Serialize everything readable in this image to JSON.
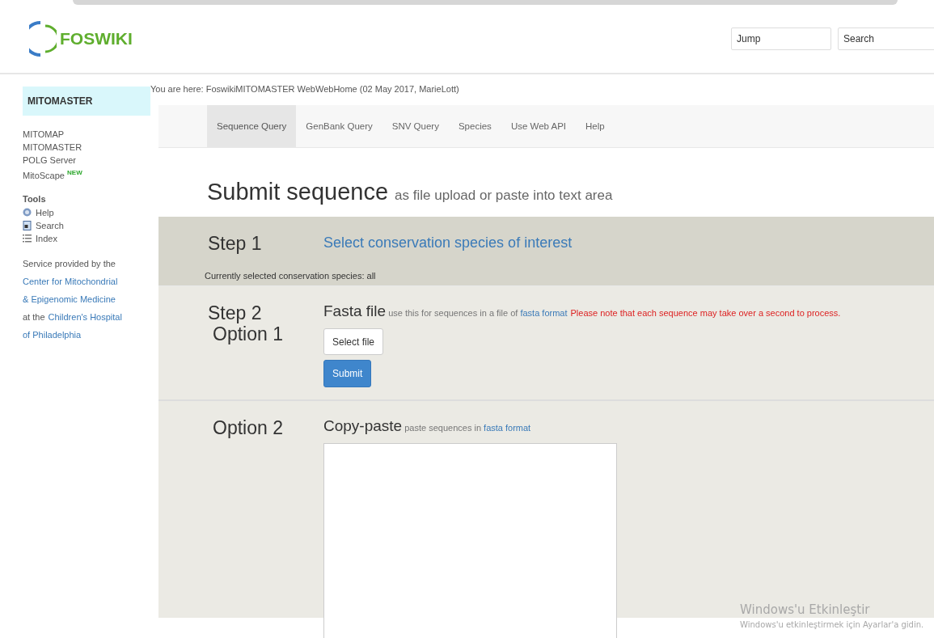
{
  "header": {
    "logo": "FOSWIKI",
    "jump_field": {
      "placeholder": "Jump"
    },
    "search_field": {
      "placeholder": "Search"
    }
  },
  "sidebar": {
    "title": "MITOMASTER",
    "links": [
      {
        "label": "MITOMAP"
      },
      {
        "label": "MITOMASTER"
      },
      {
        "label": "POLG Server"
      },
      {
        "label": "MitoScape",
        "badge": "NEW"
      }
    ],
    "tools_heading": "Tools",
    "tools": [
      {
        "label": "Help",
        "kind": "help"
      },
      {
        "label": "Search",
        "kind": "search"
      },
      {
        "label": "Index",
        "kind": "index"
      }
    ],
    "service": [
      {
        "segments": [
          {
            "text": "Service provided by the",
            "link": false
          }
        ]
      },
      {
        "segments": [
          {
            "text": "Center for Mitochondrial",
            "link": true
          }
        ]
      },
      {
        "segments": [
          {
            "text": "& Epigenomic Medicine",
            "link": true
          }
        ]
      },
      {
        "segments": [
          {
            "text": "at the",
            "link": false
          },
          {
            "text": "Children's Hospital",
            "link": true
          }
        ]
      },
      {
        "segments": [
          {
            "text": "of Philadelphia",
            "link": true
          }
        ]
      }
    ]
  },
  "breadcrumb": "You are here: FoswikiMITOMASTER WebWebHome (02 May 2017, MarieLott)",
  "tabs": [
    {
      "label": "Sequence Query",
      "selected": true
    },
    {
      "label": "GenBank Query",
      "selected": false
    },
    {
      "label": "SNV Query",
      "selected": false
    },
    {
      "label": "Species",
      "selected": false
    },
    {
      "label": "Use Web API",
      "selected": false
    },
    {
      "label": "Help",
      "selected": false
    }
  ],
  "heading": {
    "title": "Submit sequence",
    "subtitle": "as file upload or paste into text area"
  },
  "step1": {
    "label": "Step 1",
    "link": "Select conservation species of interest",
    "status": "Currently selected conservation species: all"
  },
  "step2": {
    "label": "Step 2",
    "option": "Option 1",
    "title": "Fasta file",
    "hint": "use this for sequences in a file of",
    "link": "fasta format",
    "warning": "Please note that each sequence may take over a second to process.",
    "file_button": "Select file",
    "submit_button": "Submit"
  },
  "option2": {
    "option": "Option 2",
    "title": "Copy-paste",
    "hint": "paste sequences in",
    "link": "fasta format"
  },
  "activation": {
    "title": "Windows'u Etkinleştir",
    "message": "Windows'u etkinleştirmek için Ayarlar'a gidin."
  }
}
